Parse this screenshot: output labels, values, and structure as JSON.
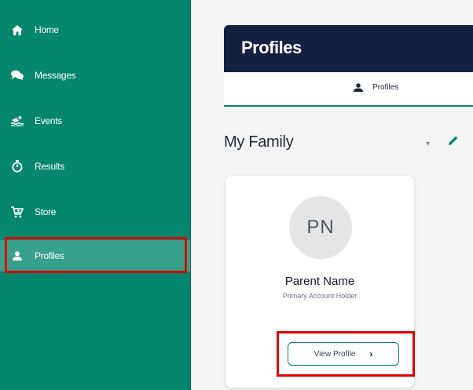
{
  "sidebar": {
    "items": [
      {
        "label": "Home",
        "icon": "home-icon",
        "active": false
      },
      {
        "label": "Messages",
        "icon": "chat-icon",
        "active": false
      },
      {
        "label": "Events",
        "icon": "swim-icon",
        "active": false
      },
      {
        "label": "Results",
        "icon": "timer-icon",
        "active": false
      },
      {
        "label": "Store",
        "icon": "cart-icon",
        "active": false
      },
      {
        "label": "Profiles",
        "icon": "person-icon",
        "active": true
      }
    ],
    "color": "#04876e",
    "active_color": "#36a08a"
  },
  "header": {
    "title": "Profiles",
    "color": "#142241"
  },
  "tabs": [
    {
      "label": "Profiles",
      "icon": "person-icon"
    }
  ],
  "family": {
    "title": "My Family",
    "expand_icon": "chevron-down-icon",
    "edit_icon": "pencil-icon"
  },
  "profile_card": {
    "initials": "PN",
    "name": "Parent Name",
    "role": "Primary Account Holder",
    "button_label": "View Profile",
    "button_icon": "chevron-right-icon"
  },
  "annotation_color": "#e00000"
}
